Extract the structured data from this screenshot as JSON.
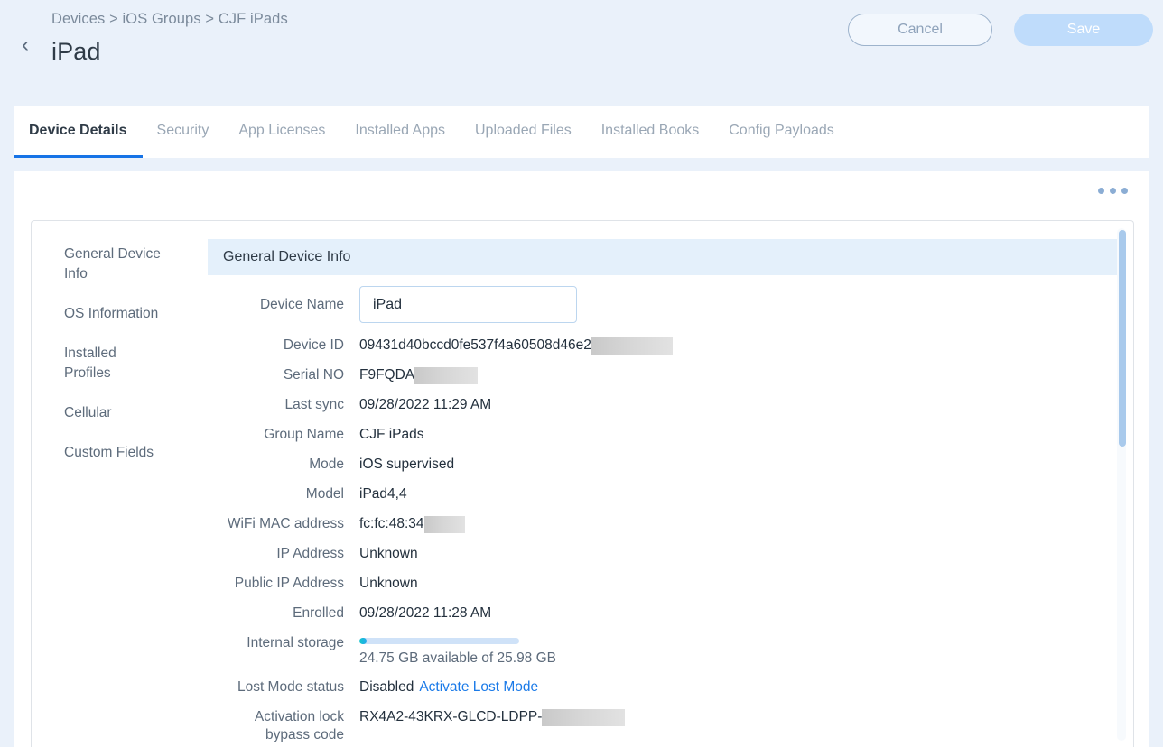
{
  "header": {
    "breadcrumb": "Devices > iOS Groups > CJF iPads",
    "title": "iPad",
    "back_icon": "chevron-left-icon",
    "cancel_label": "Cancel",
    "save_label": "Save",
    "accent_color": "#1673e6",
    "save_bg": "#bfdcfb",
    "page_bg": "#eaf1fa"
  },
  "tabs": [
    {
      "label": "Device Details",
      "active": true
    },
    {
      "label": "Security",
      "active": false
    },
    {
      "label": "App Licenses",
      "active": false
    },
    {
      "label": "Installed Apps",
      "active": false
    },
    {
      "label": "Uploaded Files",
      "active": false
    },
    {
      "label": "Installed Books",
      "active": false
    },
    {
      "label": "Config Payloads",
      "active": false
    }
  ],
  "overflow_menu": {
    "icon": "more-horizontal-icon"
  },
  "side_nav": [
    {
      "label": "General Device Info",
      "active": true
    },
    {
      "label": "OS Information",
      "active": false
    },
    {
      "label": "Installed Profiles",
      "active": false
    },
    {
      "label": "Cellular",
      "active": false
    },
    {
      "label": "Custom Fields",
      "active": false
    }
  ],
  "section": {
    "title": "General Device Info",
    "fields": {
      "device_name_label": "Device Name",
      "device_name_value": "iPad",
      "device_id_label": "Device ID",
      "device_id_value": "09431d40bccd0fe537f4a60508d46e2",
      "serial_label": "Serial NO",
      "serial_value": "F9FQDA",
      "last_sync_label": "Last sync",
      "last_sync_value": "09/28/2022 11:29 AM",
      "group_name_label": "Group Name",
      "group_name_value": "CJF iPads",
      "mode_label": "Mode",
      "mode_value": "iOS supervised",
      "model_label": "Model",
      "model_value": "iPad4,4",
      "wifi_mac_label": "WiFi MAC address",
      "wifi_mac_value": "fc:fc:48:34",
      "ip_label": "IP Address",
      "ip_value": "Unknown",
      "public_ip_label": "Public IP Address",
      "public_ip_value": "Unknown",
      "enrolled_label": "Enrolled",
      "enrolled_value": "09/28/2022 11:28 AM",
      "storage_label": "Internal storage",
      "storage_text": "24.75 GB available of 25.98 GB",
      "storage_used_percent": 4.7,
      "lost_mode_label": "Lost Mode status",
      "lost_mode_value": "Disabled",
      "lost_mode_link": "Activate Lost Mode",
      "bypass_label_line1": "Activation lock",
      "bypass_label_line2": "bypass code",
      "bypass_value": "RX4A2-43KRX-GLCD-LDPP-"
    }
  }
}
